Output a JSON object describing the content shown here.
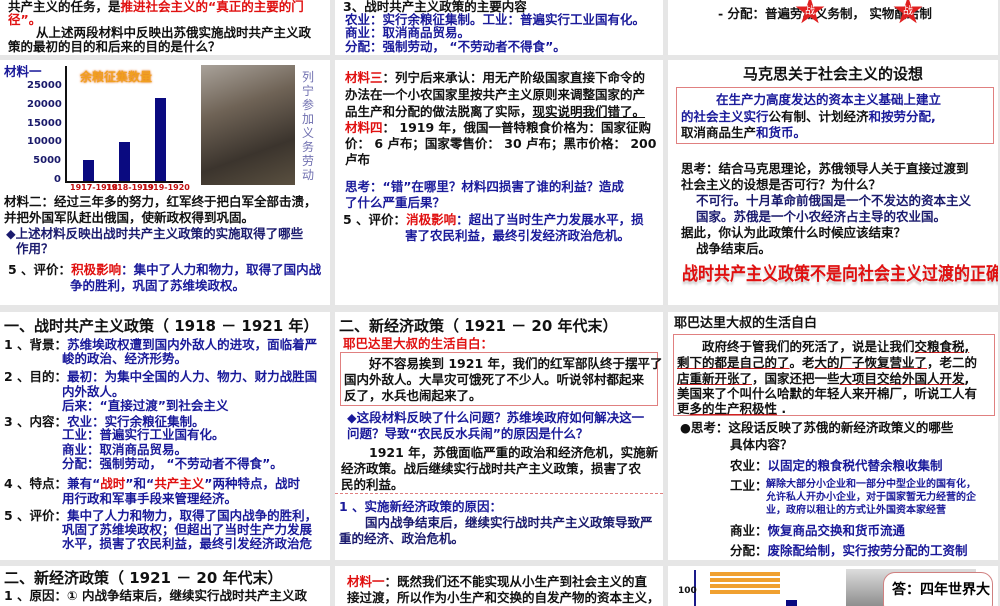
{
  "r1a": {
    "l1a": "共产主义的任务，是",
    "l1b": "推进社会主义的“真正的主要的门",
    "l2": "径”。",
    "q1": "从上述两段材料中反映出苏俄实施战时共产主义政",
    "q2": "策的最初的目的和后来的目的是什么？"
  },
  "r1b": {
    "l0": "3、战时共产主义政策的主要内容",
    "l1": "农业：实行余粮征集制。工业：普遍实行工业国有化。",
    "l2": "商业：取消商品贸易。",
    "l3": "分配：强制劳动，  “不劳动者不得食”。"
  },
  "r1c": {
    "l1": "- 分配：普遍劳动义务制，    实物配给制",
    "star": "战"
  },
  "s2a": {
    "label": "材料一",
    "side": "列宁参加义务劳动",
    "m2a": "材料二：经过三年多的努力，红军终于把白军全部击溃，",
    "m2b": "并把外国军队赶出俄国，使新政权得到巩固。",
    "qa": "◆上述材料反映出战时共产主义政策的实施取得了哪些",
    "qb": "作用？",
    "e0": "5 、评价：",
    "e1": "积极影响",
    "e2": "：集中了人力和物力，取得了国内战",
    "e3": "争的胜利，巩固了苏维埃政权。"
  },
  "chart_data": {
    "type": "bar",
    "title": "余粮征集数量",
    "categories": [
      "1917-1918",
      "1918-1919",
      "1919-1920"
    ],
    "values": [
      5500,
      10500,
      22000
    ],
    "yticks": [
      "25000",
      "20000",
      "15000",
      "10000",
      "5000",
      "0"
    ],
    "ylim": [
      0,
      25000
    ]
  },
  "s2b": {
    "m3l": "材料三",
    "m3a": "：列宁后来承认：用无产阶级国家直接下命令的",
    "m3b": "办法在一个小农国家里按共产主义原则来调整国家的产",
    "m3c": "品生产和分配的做法脱离了实际，",
    "m3d": "现实说明我们错了。",
    "m4l": "材料四",
    "m4a": "：  1919 年，俄国一普特粮食价格为：国家征购",
    "m4b": "价： 6 卢布；国家零售价： 30 卢布；黑市价格： 200",
    "m4c": "卢布",
    "t1": "思考：“错”在哪里？材料四损害了谁的利益？造成",
    "t2": "了什么严重后果？",
    "e0": "5 、评价：",
    "e1": "消极影响",
    "e2": "：超出了当时生产力发展水平，损",
    "e3": "害了农民利益，最终引发经济政治危机。"
  },
  "s2c": {
    "title": "马克思关于社会主义的设想",
    "b1": "在生产力高度发达的资本主义基础上建立",
    "b2a": "的社会主义实行",
    "b2b": "公有制、计划经济",
    "b2c": "和按劳分配,",
    "b3a": "取消商品生产",
    "b3b": "和货币。",
    "t1": "思考：结合马克思理论，苏俄领导人关于直接过渡到",
    "t2": "社会主义的设想是否可行？为什么？",
    "a1": "不可行。十月革命前俄国是一个不发达的资本主义",
    "a2": "国家。苏俄是一个小农经济占主导的农业国。",
    "t3": "据此，你认为此政策什么时候应该结束？",
    "a3": "战争结束后。",
    "big": "战时共产主义政策不是向社会主义过渡的正确途径"
  },
  "s3a": {
    "title": "一、战时共产主义政策（ 1918 － 1921 年）",
    "p1": "1 、背景：",
    "p1a": "苏维埃政权遭到国内外敌人的进攻，面临着严",
    "p1b": "峻的政治、经济形势。",
    "p2": "2 、目的：",
    "p2a": "最初：为集中全国的人力、物力、财力战胜国",
    "p2b": "内外敌人。",
    "p2c": "后来：“直接过渡”到社会主义",
    "p3": "3 、内容：",
    "p3a": "农业：实行余粮征集制。",
    "p3b": "工业：普遍实行工业国有化。",
    "p3c": "商业：取消商品贸易。",
    "p3d": "分配：强制劳动，  “不劳动者不得食”。",
    "p4": "4 、特点：",
    "p4a": "兼有“",
    "p4b": "战时",
    "p4c": "”和“",
    "p4d": "共产主义",
    "p4e": "”两种特点，战时",
    "p4f": "用行政和军事手段来管理经济。",
    "p5": "5 、评价：",
    "p5a": "集中了人力和物力，取得了国内战争的胜利，",
    "p5b": "巩固了苏维埃政权；但超出了当时生产力发展",
    "p5c": "水平，损害了农民利益，最终引发经济政治危"
  },
  "s3b": {
    "title": "二、新经济政策（ 1921 － 20 年代末）",
    "sub": "耶巴达里大叔的生活自白：",
    "b1": "好不容易挨到 1921 年，我们的红军部队终于摆平了",
    "b2": "国内外敌人。大旱灾可饿死了不少人。听说邻村都起来",
    "b3": "反了，水兵也闹起来了。",
    "q1": "◆这段材料反映了什么问题？苏维埃政府如何解决这一",
    "q2": "问题？导致“农民反水兵闹”的原因是什么？",
    "a1": "1921 年，苏俄面临严重的政治和经济危机，实施新",
    "a2": "经济政策。战后继续实行战时共产主义政策，损害了农",
    "a3": "民的利益。",
    "c1": "1 、实施新经济政策的原因：",
    "c2": "国内战争结束后，继续实行战时共产主义政策导致严",
    "c3": "重的经济、政治危机。"
  },
  "s3c": {
    "title": "耶巴达里大叔的生活自白",
    "b1a": "政府终于管我们的死活了，说是让我们",
    "b1b": "交粮食税,",
    "b2a": "剩下的都是自己的了",
    "b2b": "。老",
    "b2c": "大的厂子恢复营业了",
    "b2d": "，老二的",
    "b3a": "店重新开张了",
    "b3b": "，国家还把一些",
    "b3c": "大项目交给外国人开发",
    "b3d": ",",
    "b4": "美国来了个叫什么哈默的年轻人来开棉厂，听说工人有",
    "b5a": "更",
    "b5b": "多的生产积极性",
    "b5c": " .",
    "t1": "●思考：这段话反映了苏俄的新经济政策义的哪些",
    "t2": "具体内容？",
    "n1": "农业：",
    "n1v": "以固定的粮食税代替余粮收集制",
    "n2": "工业：",
    "n2a": "解除大部分小企业和一部分中型企业的国有化，",
    "n2b": "允许私人开办小企业，对于国家暂无力经营的企",
    "n2c": "业，政府以租让的方式让外国资本家经营",
    "n3": "商业：",
    "n3v": "恢复商品交换和货币流通",
    "n4": "分配：",
    "n4v": "废除配给制，实行按劳分配的工资制"
  },
  "r4a": {
    "title": "二、新经济政策（ 1921 － 20 年代末）",
    "l1": "1 、原因：① 内战争结束后，继续实行战时共产主义政"
  },
  "r4b": {
    "l0": "材料一",
    "l1": "：既然我们还不能实现从小生产到社会主义的直",
    "l2": "接过渡，所以作为小生产和交换的自发产物的资本主义，"
  },
  "r4c": {
    "tick": "100",
    "ans": "答：四年世界大"
  }
}
